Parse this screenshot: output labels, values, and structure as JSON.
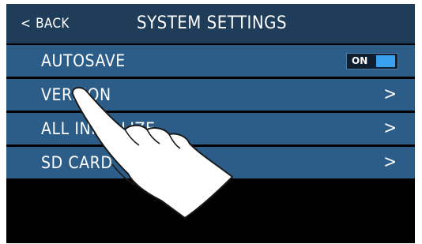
{
  "header": {
    "back_chevron": "<",
    "back_label": "BACK",
    "title": "SYSTEM SETTINGS"
  },
  "menu": [
    {
      "label": "AUTOSAVE",
      "control": "toggle",
      "toggle_text": "ON"
    },
    {
      "label": "VERSION",
      "control": "arrow",
      "arrow": ">"
    },
    {
      "label": "ALL INITIALIZE",
      "control": "arrow",
      "arrow": ">"
    },
    {
      "label": "SD CARD",
      "control": "arrow",
      "arrow": ">"
    }
  ],
  "colors": {
    "header_bg": "#1f3c59",
    "row_bg": "#2c5d88",
    "screen_bg": "#000000",
    "toggle_accent": "#3aa0f0"
  },
  "icons": {
    "touch_gesture": "hand-tap-icon"
  }
}
